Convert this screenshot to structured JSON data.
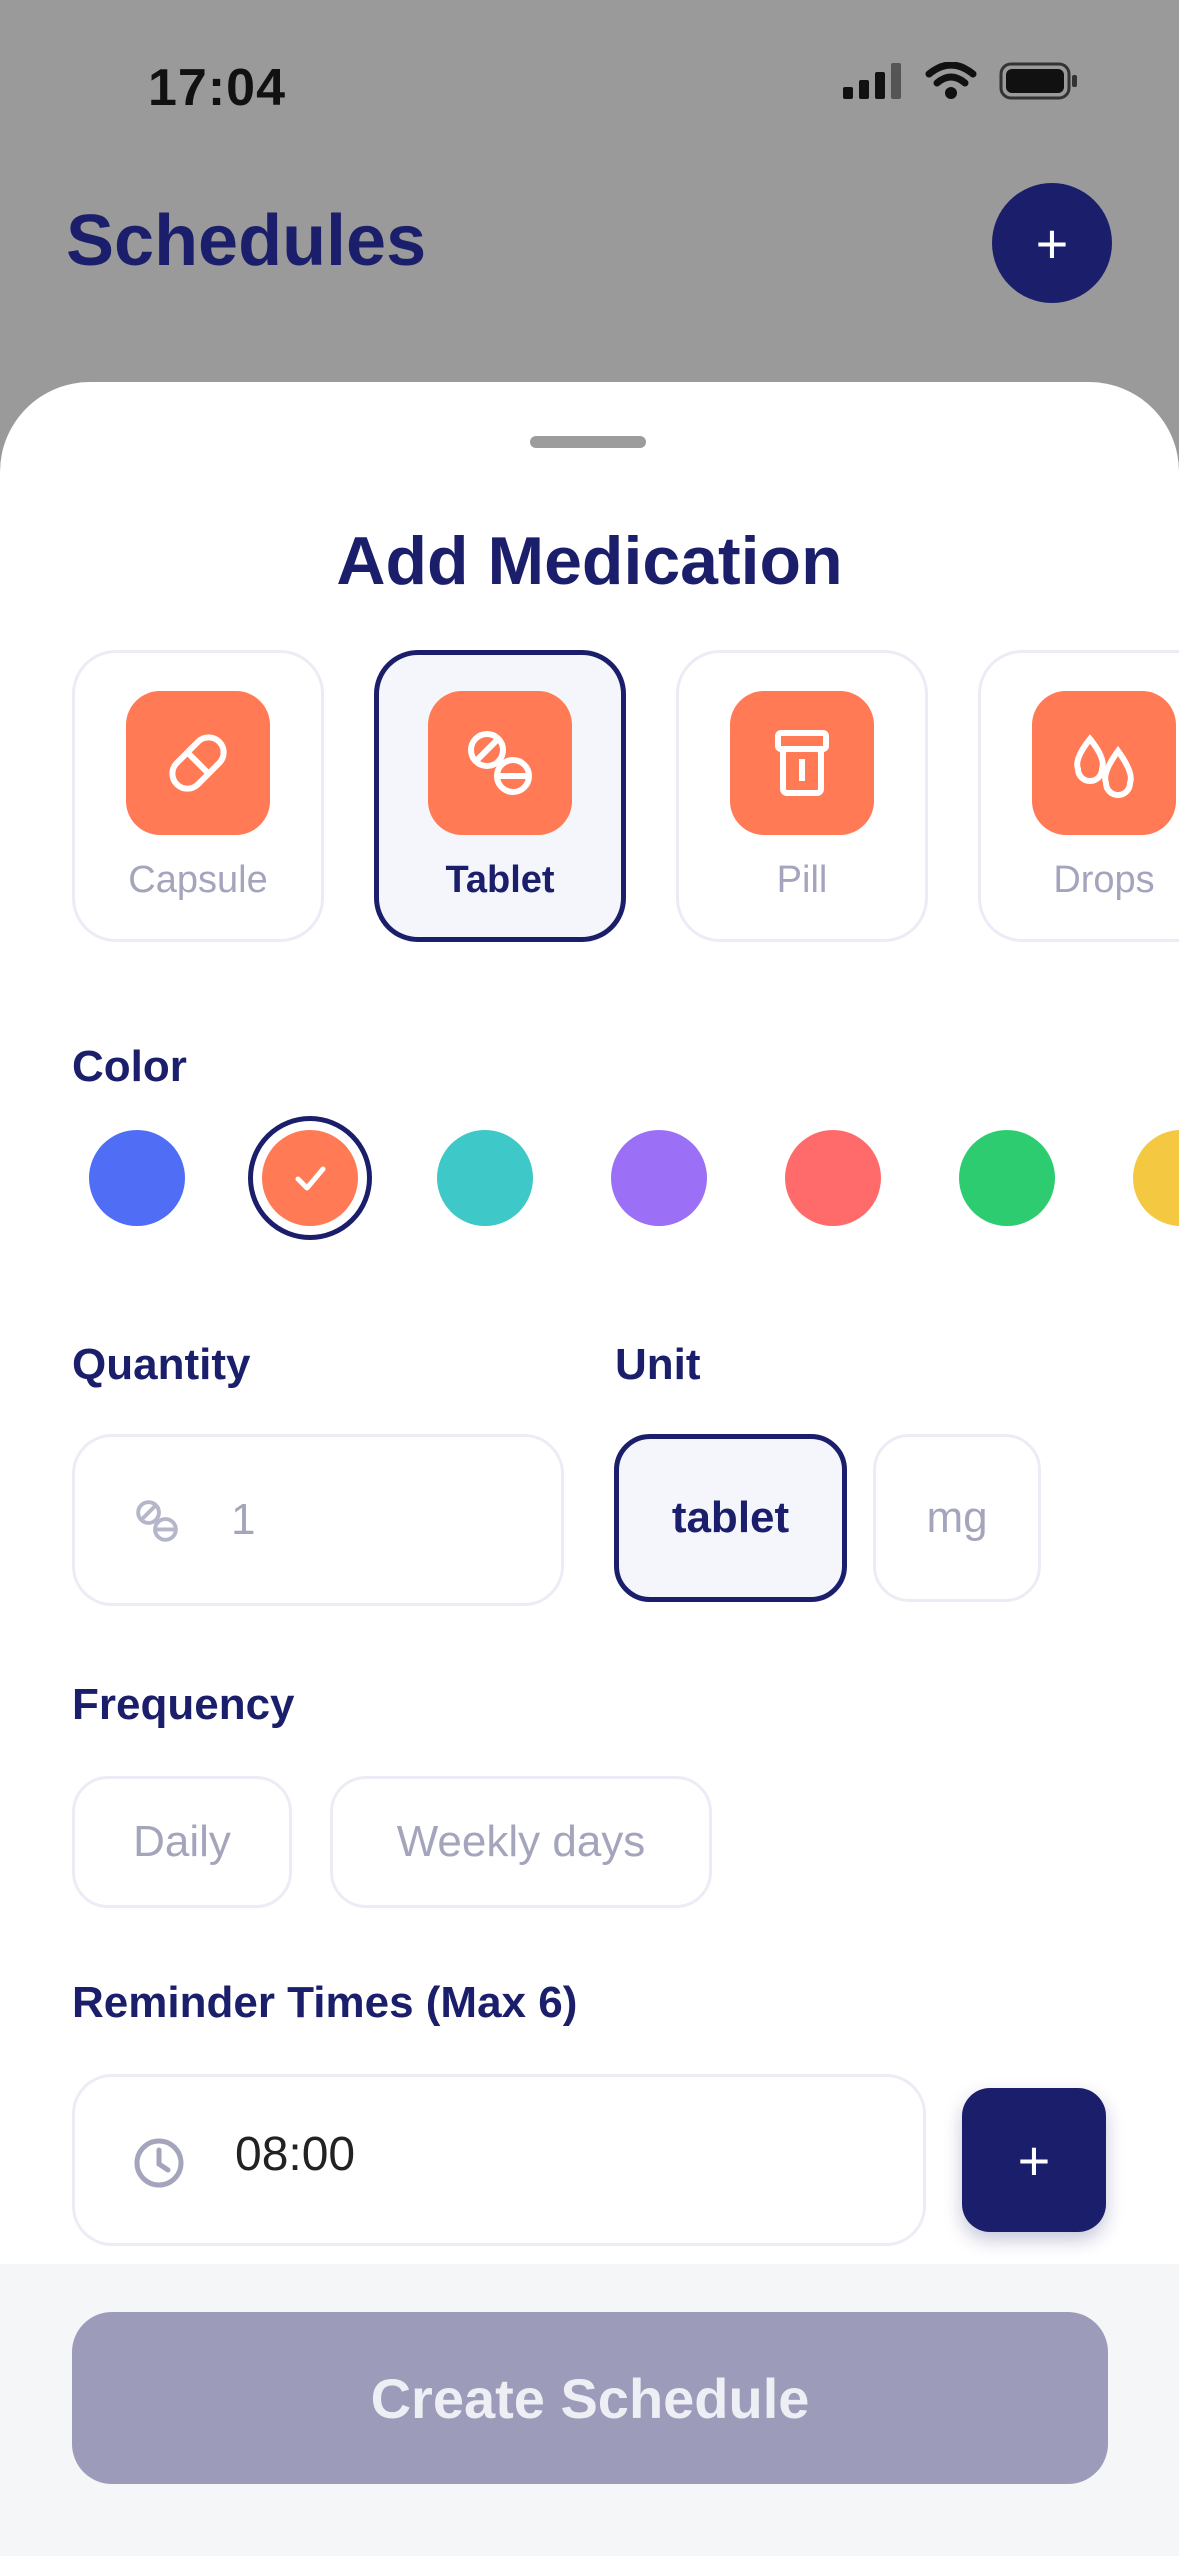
{
  "status_bar": {
    "time": "17:04"
  },
  "background": {
    "title": "Schedules",
    "add_label": "+"
  },
  "sheet": {
    "title": "Add Medication",
    "types": [
      {
        "label": "Capsule",
        "icon": "capsule-icon",
        "selected": false
      },
      {
        "label": "Tablet",
        "icon": "tablet-icon",
        "selected": true
      },
      {
        "label": "Pill",
        "icon": "pill-bottle-icon",
        "selected": false
      },
      {
        "label": "Drops",
        "icon": "drops-icon",
        "selected": false
      }
    ],
    "color": {
      "label": "Color",
      "swatches": [
        "#4f6df5",
        "#ff7a55",
        "#3ec8c8",
        "#9b6ff6",
        "#ff6b6b",
        "#2ecc71",
        "#f5c842"
      ],
      "selected_index": 1
    },
    "quantity": {
      "label": "Quantity",
      "value": "1",
      "icon": "tablet-icon"
    },
    "unit": {
      "label": "Unit",
      "options": [
        "tablet",
        "mg"
      ],
      "selected": "tablet"
    },
    "frequency": {
      "label": "Frequency",
      "options": [
        "Daily",
        "Weekly days"
      ]
    },
    "reminders": {
      "label": "Reminder Times (Max 6)",
      "time": "08:00",
      "icon": "clock-icon",
      "add_label": "+"
    },
    "create_label": "Create Schedule"
  },
  "colors": {
    "navy": "#1b1f6b",
    "accent": "#ff7a55",
    "disabled": "#9c9cba"
  }
}
